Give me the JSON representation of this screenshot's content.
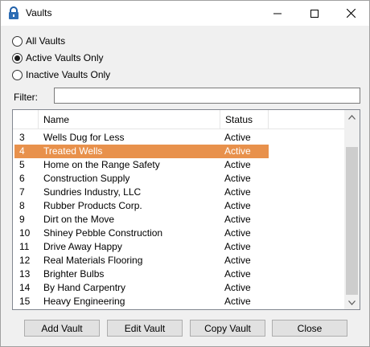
{
  "window": {
    "title": "Vaults",
    "controls": {
      "minimize": "minimize",
      "maximize": "maximize",
      "close": "close"
    }
  },
  "filter_options": [
    {
      "label": "All Vaults",
      "checked": false
    },
    {
      "label": "Active Vaults Only",
      "checked": true
    },
    {
      "label": "Inactive Vaults Only",
      "checked": false
    }
  ],
  "filter": {
    "label": "Filter:",
    "value": ""
  },
  "list": {
    "columns": [
      "",
      "Name",
      "Status"
    ],
    "rows": [
      {
        "num": "3",
        "name": "Wells Dug for Less",
        "status": "Active",
        "selected": false
      },
      {
        "num": "4",
        "name": "Treated Wells",
        "status": "Active",
        "selected": true
      },
      {
        "num": "5",
        "name": "Home on the Range Safety",
        "status": "Active",
        "selected": false
      },
      {
        "num": "6",
        "name": "Construction Supply",
        "status": "Active",
        "selected": false
      },
      {
        "num": "7",
        "name": "Sundries Industry, LLC",
        "status": "Active",
        "selected": false
      },
      {
        "num": "8",
        "name": "Rubber Products Corp.",
        "status": "Active",
        "selected": false
      },
      {
        "num": "9",
        "name": "Dirt on the Move",
        "status": "Active",
        "selected": false
      },
      {
        "num": "10",
        "name": "Shiney Pebble Construction",
        "status": "Active",
        "selected": false
      },
      {
        "num": "11",
        "name": "Drive Away Happy",
        "status": "Active",
        "selected": false
      },
      {
        "num": "12",
        "name": "Real Materials Flooring",
        "status": "Active",
        "selected": false
      },
      {
        "num": "13",
        "name": "Brighter Bulbs",
        "status": "Active",
        "selected": false
      },
      {
        "num": "14",
        "name": "By Hand Carpentry",
        "status": "Active",
        "selected": false
      },
      {
        "num": "15",
        "name": "Heavy Engineering",
        "status": "Active",
        "selected": false
      }
    ]
  },
  "buttons": {
    "add": {
      "mnemonic": "A",
      "rest": "dd Vault"
    },
    "edit": {
      "mnemonic": "E",
      "rest": "dit Vault"
    },
    "copy": {
      "mnemonic": "C",
      "rest": "opy Vault"
    },
    "close": {
      "mnemonic": "C",
      "rest": "lose"
    }
  },
  "colors": {
    "selection": "#e8914c",
    "window_bg": "#f0f0f0"
  }
}
